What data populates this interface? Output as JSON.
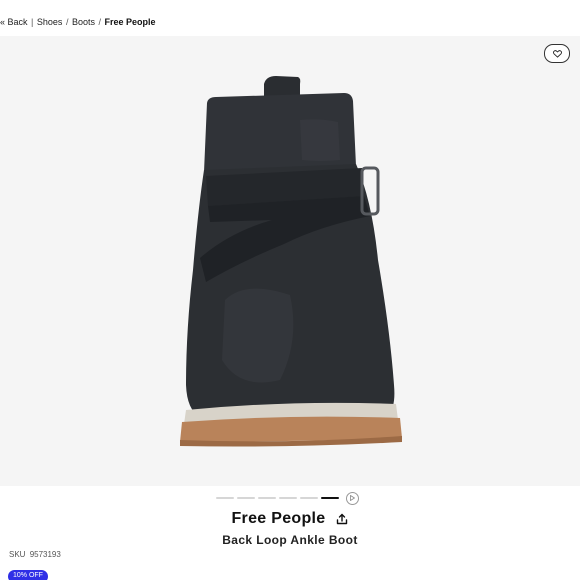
{
  "breadcrumb": {
    "back": "« Back",
    "separator_1": "|",
    "items": [
      "Shoes",
      "Boots"
    ],
    "separator": "/",
    "current": "Free People"
  },
  "gallery": {
    "image_alt": "Back Loop Ankle Boot",
    "total_images": 6,
    "active_index": 5,
    "has_video": true,
    "favorite_icon": "heart-icon",
    "play_icon": "play-icon"
  },
  "product": {
    "brand": "Free People",
    "share_icon": "share-icon",
    "name": "Back Loop Ankle Boot",
    "sku_label": "SKU",
    "sku": "9573193",
    "discount_badge": "10% OFF"
  },
  "colors": {
    "badge": "#2f2fe6",
    "gallery_bg": "#f5f5f5",
    "boot": "#2c2f33",
    "sole": "#b9835a"
  }
}
